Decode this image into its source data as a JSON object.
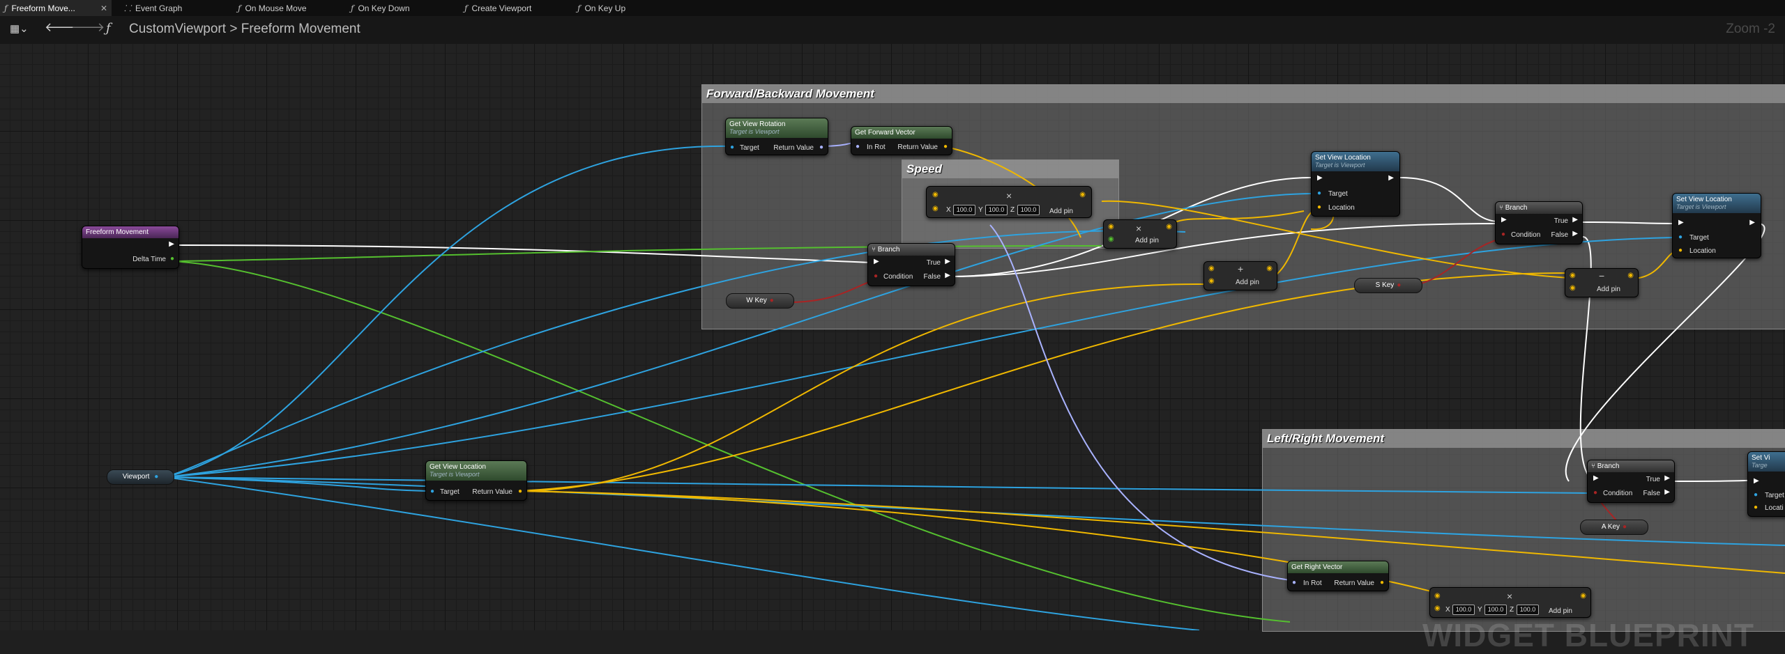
{
  "tabs": [
    {
      "label": "Freeform Move...",
      "active": true
    },
    {
      "label": "Event Graph"
    },
    {
      "label": "On Mouse Move"
    },
    {
      "label": "On Key Down"
    },
    {
      "label": "Create Viewport"
    },
    {
      "label": "On Key Up"
    }
  ],
  "toolbar": {
    "breadcrumb_root": "CustomViewport",
    "breadcrumb_sep": ">",
    "breadcrumb_current": "Freeform Movement",
    "zoom": "Zoom -2"
  },
  "comments": {
    "forward": "Forward/Backward Movement",
    "speed": "Speed",
    "leftright": "Left/Right Movement"
  },
  "nodes": {
    "freeform": {
      "title": "Freeform Movement",
      "out": "Delta Time"
    },
    "viewport": "Viewport",
    "get_view_rotation": {
      "title": "Get View Rotation",
      "sub": "Target is Viewport",
      "in": "Target",
      "out": "Return Value"
    },
    "get_forward_vector": {
      "title": "Get Forward Vector",
      "in": "In Rot",
      "out": "Return Value"
    },
    "get_view_location": {
      "title": "Get View Location",
      "sub": "Target is Viewport",
      "in": "Target",
      "out": "Return Value"
    },
    "get_right_vector": {
      "title": "Get Right Vector",
      "in": "In Rot",
      "out": "Return Value"
    },
    "set_view_location_1": {
      "title": "Set View Location",
      "sub": "Target is Viewport",
      "target": "Target",
      "location": "Location"
    },
    "set_view_location_2": {
      "title": "Set View Location",
      "sub": "Target is Viewport",
      "target": "Target",
      "location": "Location"
    },
    "set_view_location_3": {
      "title": "Set Vi",
      "sub": "Targe",
      "target": "Target",
      "location": "Locati"
    },
    "branch": {
      "title": "Branch",
      "true": "True",
      "false": "False",
      "condition": "Condition"
    },
    "add_pin": "Add pin",
    "keys": {
      "w": "W Key",
      "s": "S Key",
      "a": "A Key"
    },
    "vec": {
      "x": "X",
      "y": "Y",
      "z": "Z",
      "xv": "100.0",
      "yv": "100.0",
      "zv": "100.0"
    }
  },
  "watermark": "WIDGET BLUEPRINT"
}
